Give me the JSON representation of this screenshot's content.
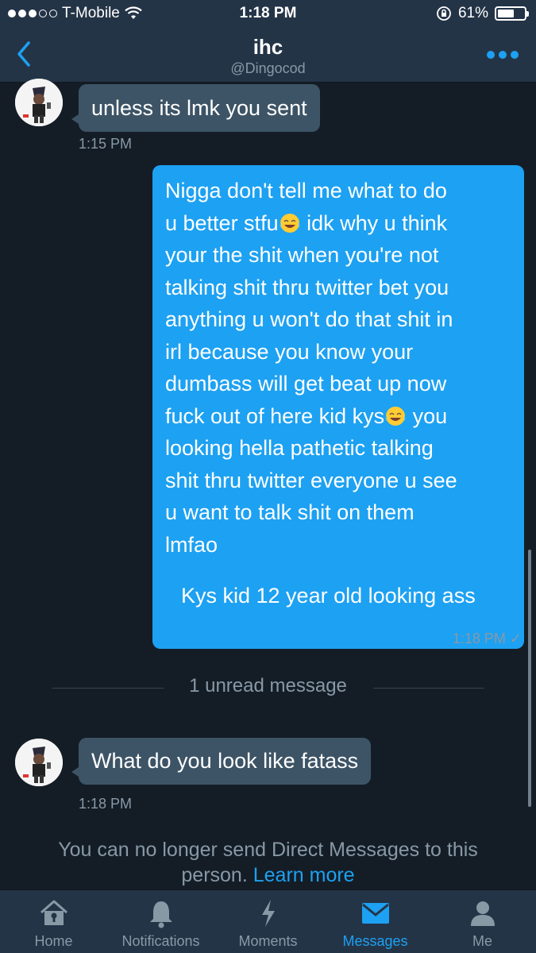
{
  "status_bar": {
    "carrier": "T-Mobile",
    "time": "1:18 PM",
    "battery": "61%",
    "battery_level": 0.61
  },
  "header": {
    "title": "ihc",
    "handle": "@Dingocod"
  },
  "messages": [
    {
      "direction": "incoming",
      "text": "unless its lmk you sent",
      "time": "1:15 PM"
    },
    {
      "direction": "outgoing",
      "lines": [
        "Nigga don't tell me what to do",
        "u better stfu",
        " idk why u think",
        "your the shit when you're not",
        "talking shit thru twitter bet you",
        "anything u won't do that shit in",
        "irl because you know your",
        "dumbass will get beat up now",
        "fuck out of here kid kys",
        " you",
        "looking hella pathetic talking",
        "shit thru twitter everyone u see",
        "u want to talk shit on them",
        "lmfao"
      ]
    },
    {
      "direction": "outgoing",
      "text": "Kys kid 12 year old looking ass",
      "time": "1:18 PM ✓"
    },
    {
      "direction": "incoming",
      "text": "What do you look like fatass",
      "time": "1:18 PM"
    }
  ],
  "unread_divider": "1 unread message",
  "notice": {
    "text": "You can no longer send Direct Messages to this person.",
    "link": "Learn more"
  },
  "tabs": [
    {
      "label": "Home",
      "icon": "home-icon"
    },
    {
      "label": "Notifications",
      "icon": "bell-icon"
    },
    {
      "label": "Moments",
      "icon": "lightning-icon"
    },
    {
      "label": "Messages",
      "icon": "envelope-icon",
      "active": true
    },
    {
      "label": "Me",
      "icon": "person-icon"
    }
  ],
  "colors": {
    "background": "#141d26",
    "bar": "#243447",
    "accent": "#1da1f2",
    "incoming_bubble": "#3d5466",
    "muted_text": "#8899a6"
  }
}
